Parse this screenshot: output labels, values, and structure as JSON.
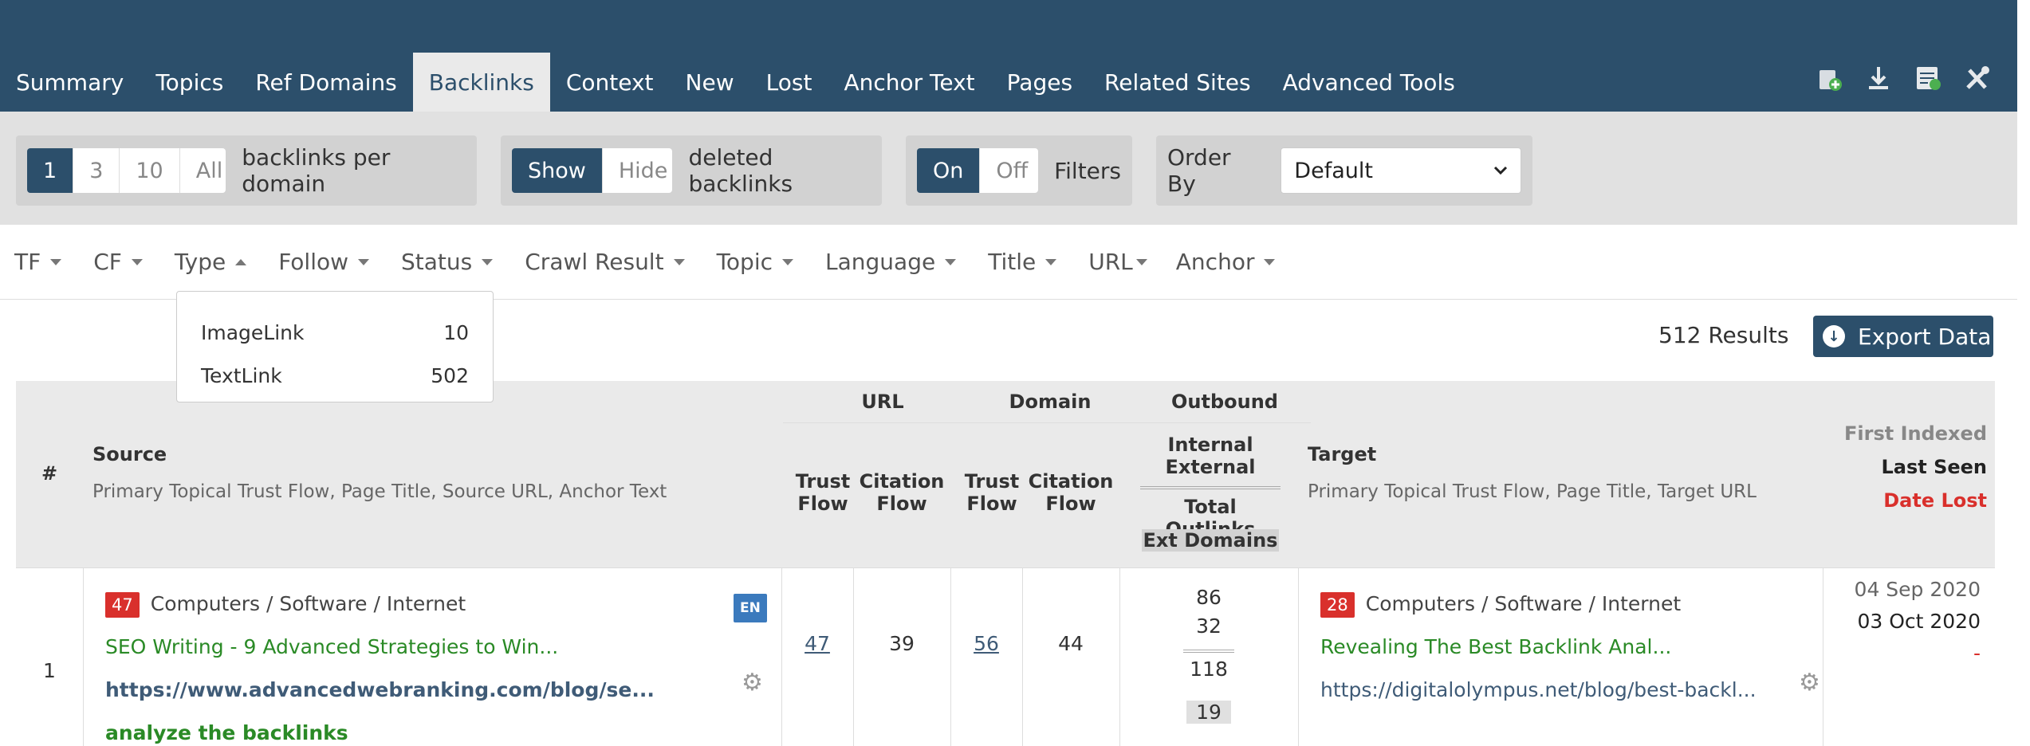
{
  "nav": {
    "tabs": [
      {
        "label": "Summary"
      },
      {
        "label": "Topics"
      },
      {
        "label": "Ref Domains"
      },
      {
        "label": "Backlinks",
        "active": true
      },
      {
        "label": "Context"
      },
      {
        "label": "New"
      },
      {
        "label": "Lost"
      },
      {
        "label": "Anchor Text"
      },
      {
        "label": "Pages"
      },
      {
        "label": "Related Sites"
      },
      {
        "label": "Advanced Tools"
      }
    ],
    "icons": [
      "add-to-bucket-icon",
      "download-icon",
      "report-icon",
      "tools-icon"
    ]
  },
  "controls": {
    "per_domain": {
      "options": [
        "1",
        "3",
        "10",
        "All"
      ],
      "selected": "1",
      "label": "backlinks per domain"
    },
    "deleted": {
      "options": [
        "Show",
        "Hide"
      ],
      "selected": "Show",
      "label": "deleted backlinks"
    },
    "filters": {
      "options": [
        "On",
        "Off"
      ],
      "selected": "On",
      "label": "Filters"
    },
    "order_by": {
      "label": "Order By",
      "value": "Default"
    }
  },
  "filters": [
    "TF",
    "CF",
    "Type",
    "Follow",
    "Status",
    "Crawl Result",
    "Topic",
    "Language",
    "Title",
    "URL",
    "Anchor"
  ],
  "type_dropdown": [
    {
      "label": "ImageLink",
      "count": "10"
    },
    {
      "label": "TextLink",
      "count": "502"
    }
  ],
  "results": {
    "count_text": "512 Results",
    "export_label": "Export Data"
  },
  "table_header": {
    "hash": "#",
    "source": "Source",
    "source_sub": "Primary Topical Trust Flow, Page Title, Source URL, Anchor Text",
    "url_group": "URL",
    "domain_group": "Domain",
    "outbound_group": "Outbound",
    "trust_flow": "Trust Flow",
    "citation_flow": "Citation Flow",
    "internal": "Internal",
    "external": "External",
    "total_outlinks": "Total Outlinks",
    "ext_domains": "Ext Domains",
    "target": "Target",
    "target_sub": "Primary Topical Trust Flow, Page Title, Target URL",
    "first_indexed": "First Indexed",
    "last_seen": "Last Seen",
    "date_lost": "Date Lost"
  },
  "rows": [
    {
      "index": "1",
      "source_tf": "47",
      "source_topic": "Computers / Software / Internet",
      "source_title": "SEO Writing - 9 Advanced Strategies to Win...",
      "source_url": "https://www.advancedwebranking.com/blog/se...",
      "anchor": "analyze the backlinks",
      "lang": "EN",
      "url_tf": "47",
      "url_cf": "39",
      "domain_tf": "56",
      "domain_cf": "44",
      "internal": "86",
      "external": "32",
      "total_outlinks": "118",
      "ext_domains": "19",
      "target_tf": "28",
      "target_topic": "Computers / Software / Internet",
      "target_title": "Revealing The Best Backlink Anal...",
      "target_url": "https://digitalolympus.net/blog/best-backl...",
      "first_indexed": "04 Sep 2020",
      "last_seen": "03 Oct 2020",
      "date_lost": "-"
    }
  ]
}
